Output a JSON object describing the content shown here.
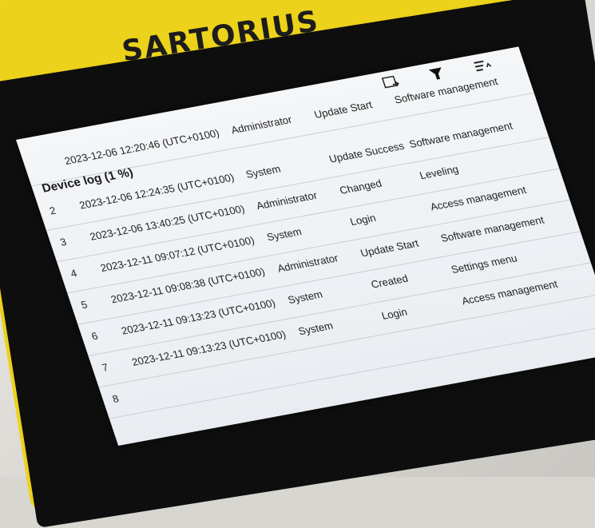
{
  "brand": {
    "logo_text": "SARTORIUS"
  },
  "toolbar": {
    "icons": [
      "export-icon",
      "filter-icon",
      "sort-icon"
    ]
  },
  "log": {
    "title": "Device log (1 %)",
    "header_partial": {
      "timestamp": "2023-12-06 12:20:46 (UTC+0100)",
      "user": "Administrator",
      "action": "Update Start",
      "category": "Software management"
    },
    "rows": [
      {
        "no": "2",
        "timestamp": "2023-12-06 12:24:35 (UTC+0100)",
        "user": "System",
        "action": "Update Success",
        "category": "Software management"
      },
      {
        "no": "3",
        "timestamp": "2023-12-06 13:40:25 (UTC+0100)",
        "user": "Administrator",
        "action": "Changed",
        "category": "Leveling"
      },
      {
        "no": "4",
        "timestamp": "2023-12-11 09:07:12 (UTC+0100)",
        "user": "System",
        "action": "Login",
        "category": "Access management"
      },
      {
        "no": "5",
        "timestamp": "2023-12-11 09:08:38 (UTC+0100)",
        "user": "Administrator",
        "action": "Update Start",
        "category": "Software management"
      },
      {
        "no": "6",
        "timestamp": "2023-12-11 09:13:23 (UTC+0100)",
        "user": "System",
        "action": "Created",
        "category": "Settings menu"
      },
      {
        "no": "7",
        "timestamp": "2023-12-11 09:13:23 (UTC+0100)",
        "user": "System",
        "action": "Login",
        "category": "Access management"
      },
      {
        "no": "8",
        "timestamp": "",
        "user": "",
        "action": "",
        "category": ""
      }
    ]
  }
}
